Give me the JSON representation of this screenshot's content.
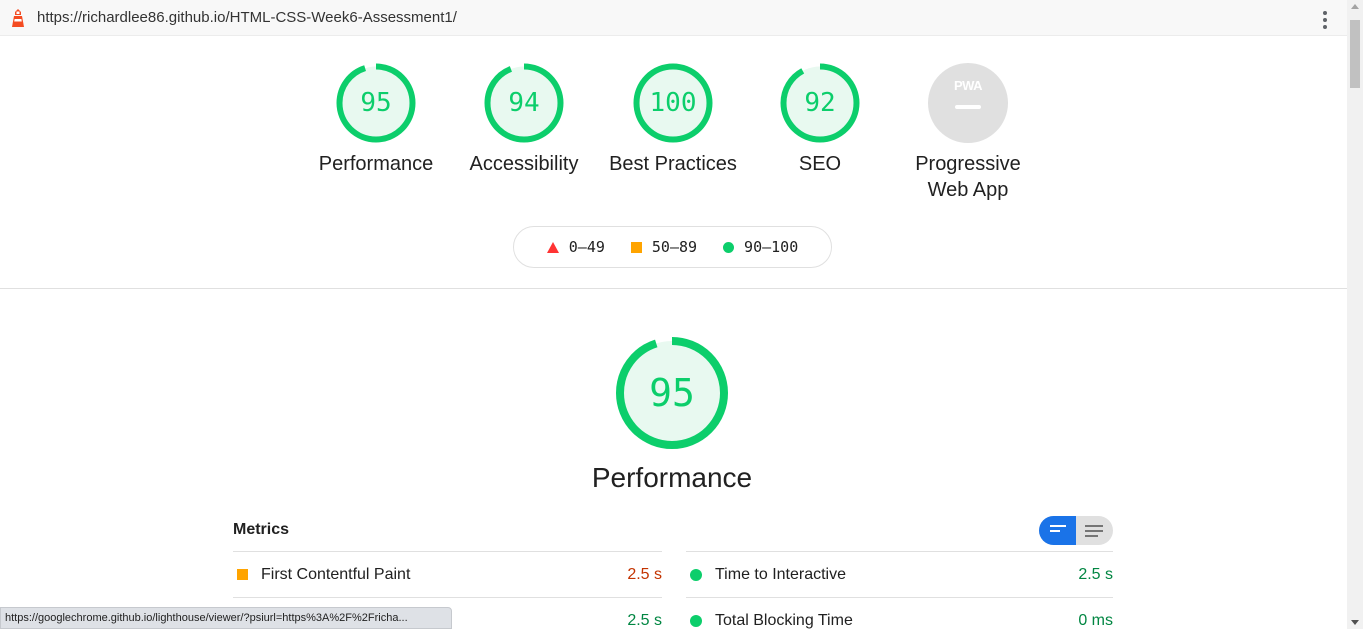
{
  "browser": {
    "url": "https://richardlee86.github.io/HTML-CSS-Week6-Assessment1/",
    "status_url": "https://googlechrome.github.io/lighthouse/viewer/?psiurl=https%3A%2F%2Fricha..."
  },
  "gauges": [
    {
      "score": "95",
      "label": "Performance",
      "value": 95
    },
    {
      "score": "94",
      "label": "Accessibility",
      "value": 94
    },
    {
      "score": "100",
      "label": "Best Practices",
      "value": 100
    },
    {
      "score": "92",
      "label": "SEO",
      "value": 92
    }
  ],
  "pwa": {
    "badge": "PWA",
    "label_line1": "Progressive",
    "label_line2": "Web App"
  },
  "legend": {
    "fail": "0–49",
    "average": "50–89",
    "pass": "90–100"
  },
  "performance": {
    "score": "95",
    "value": 95,
    "title": "Performance"
  },
  "metrics": {
    "header": "Metrics",
    "rows": [
      {
        "name": "First Contentful Paint",
        "value": "2.5 s",
        "status": "average"
      },
      {
        "name": "Time to Interactive",
        "value": "2.5 s",
        "status": "pass"
      },
      {
        "name": "",
        "value": "2.5 s",
        "status": "pass"
      },
      {
        "name": "Total Blocking Time",
        "value": "0 ms",
        "status": "pass"
      }
    ]
  },
  "colors": {
    "pass": "#0cce6b",
    "average": "#ffa400",
    "fail": "#ff3333",
    "accent": "#1a73e8"
  }
}
